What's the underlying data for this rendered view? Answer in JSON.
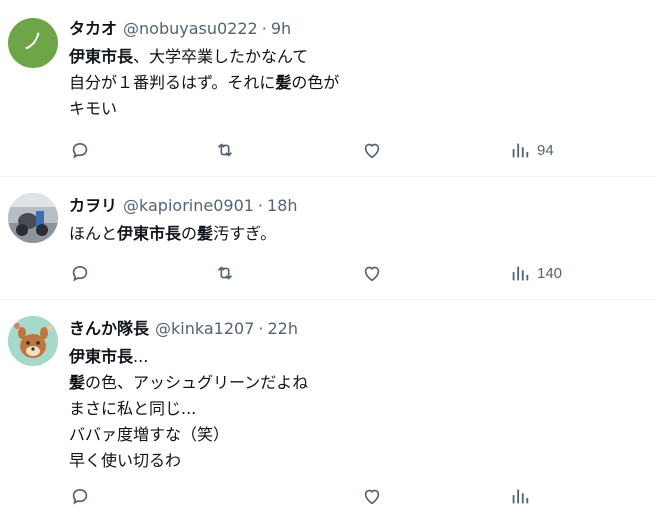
{
  "tweets": [
    {
      "name": "タカオ",
      "handle": "@nobuyasu0222",
      "sep": "·",
      "time": "9h",
      "avatar_color": "#6ea547",
      "avatar_glyph": "ノ",
      "lines": [
        [
          {
            "t": "伊東市長",
            "b": true
          },
          {
            "t": "、大学卒業したかなんて",
            "b": false
          }
        ],
        [
          {
            "t": "自分が１番判るはず。それに",
            "b": false
          },
          {
            "t": "髪",
            "b": true
          },
          {
            "t": "の色が",
            "b": false
          }
        ],
        [
          {
            "t": "キモい",
            "b": false
          }
        ]
      ],
      "views": "94"
    },
    {
      "name": "カヲリ",
      "handle": "@kapiorine0901",
      "sep": "·",
      "time": "18h",
      "lines": [
        [
          {
            "t": "ほんと",
            "b": false
          },
          {
            "t": "伊東市長",
            "b": true
          },
          {
            "t": "の",
            "b": false
          },
          {
            "t": "髪",
            "b": true
          },
          {
            "t": "汚すぎ。",
            "b": false
          }
        ]
      ],
      "views": "140"
    },
    {
      "name": "きんか隊長",
      "handle": "@kinka1207",
      "sep": "·",
      "time": "22h",
      "lines": [
        [
          {
            "t": "伊東市長",
            "b": true
          },
          {
            "t": "...",
            "b": false
          }
        ],
        [
          {
            "t": "髪",
            "b": true
          },
          {
            "t": "の色、アッシュグリーンだよね",
            "b": false
          }
        ],
        [
          {
            "t": "まさに私と同じ...",
            "b": false
          }
        ],
        [
          {
            "t": "ババァ度増すな（笑）",
            "b": false
          }
        ],
        [
          {
            "t": "早く使い切るわ",
            "b": false
          }
        ]
      ]
    }
  ],
  "icons": [
    "reply-icon",
    "retweet-icon",
    "like-icon",
    "views-icon"
  ]
}
